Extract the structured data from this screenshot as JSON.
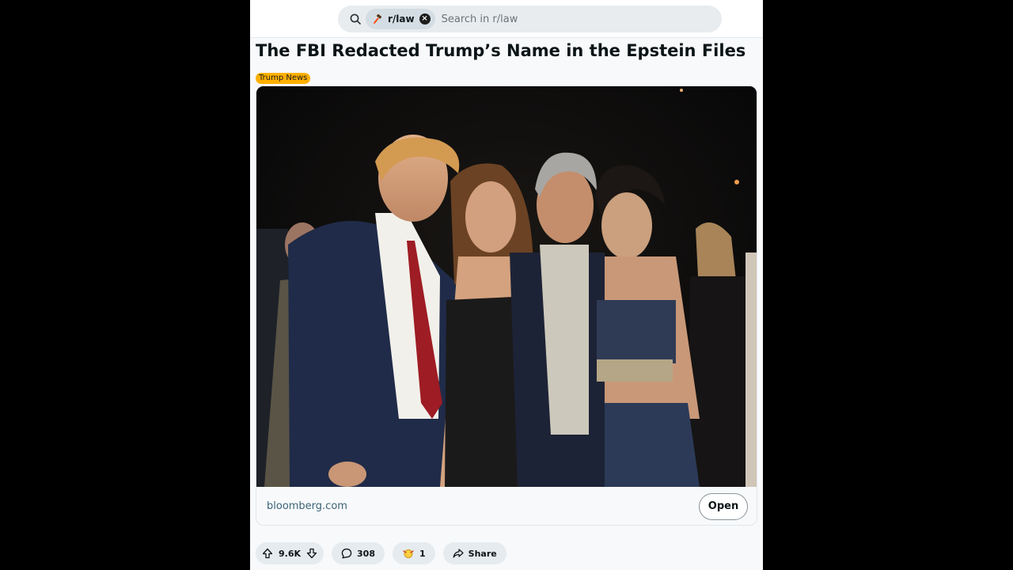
{
  "search": {
    "community": "r/law",
    "placeholder": "Search in r/law",
    "clear_symbol": "×"
  },
  "post": {
    "title": "The FBI Redacted Trump’s Name in the Epstein Files",
    "flair": "Trump News",
    "flair_color": "#ffb000",
    "link": {
      "domain": "bloomberg.com",
      "open_label": "Open"
    }
  },
  "actions": {
    "score": "9.6K",
    "comments": "308",
    "awards": "1",
    "share": "Share"
  },
  "icons": [
    "search-icon",
    "gavel-icon",
    "close-icon",
    "upvote-icon",
    "downvote-icon",
    "comment-icon",
    "award-icon",
    "share-icon"
  ]
}
